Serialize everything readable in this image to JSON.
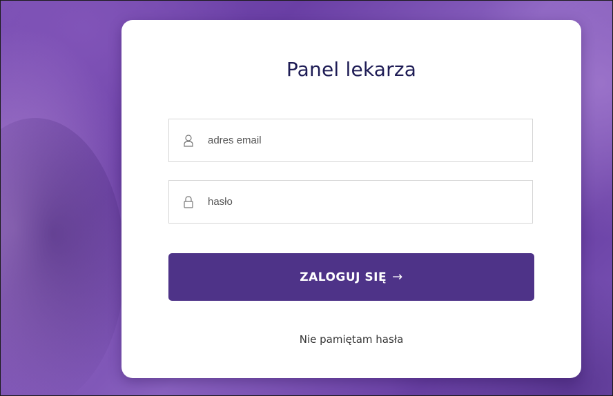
{
  "panel": {
    "title": "Panel lekarza"
  },
  "form": {
    "email": {
      "placeholder": "adres email",
      "value": "",
      "icon": "user-icon"
    },
    "password": {
      "placeholder": "hasło",
      "value": "",
      "icon": "lock-icon"
    },
    "submit_label": "ZALOGUJ SIĘ",
    "submit_icon": "→",
    "forgot_label": "Nie pamiętam hasła"
  },
  "colors": {
    "accent": "#4e3388",
    "title": "#1e1c55",
    "background": "#7a4fb3"
  }
}
